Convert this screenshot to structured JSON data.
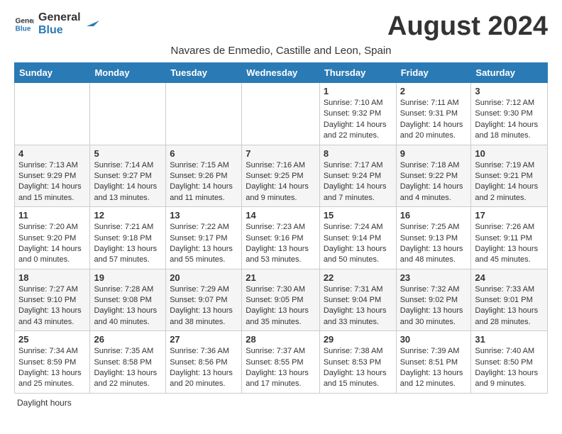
{
  "header": {
    "logo_general": "General",
    "logo_blue": "Blue",
    "month_title": "August 2024",
    "subtitle": "Navares de Enmedio, Castille and Leon, Spain"
  },
  "days_of_week": [
    "Sunday",
    "Monday",
    "Tuesday",
    "Wednesday",
    "Thursday",
    "Friday",
    "Saturday"
  ],
  "weeks": [
    [
      {
        "day": "",
        "sunrise": "",
        "sunset": "",
        "daylight": ""
      },
      {
        "day": "",
        "sunrise": "",
        "sunset": "",
        "daylight": ""
      },
      {
        "day": "",
        "sunrise": "",
        "sunset": "",
        "daylight": ""
      },
      {
        "day": "",
        "sunrise": "",
        "sunset": "",
        "daylight": ""
      },
      {
        "day": "1",
        "sunrise": "Sunrise: 7:10 AM",
        "sunset": "Sunset: 9:32 PM",
        "daylight": "Daylight: 14 hours and 22 minutes."
      },
      {
        "day": "2",
        "sunrise": "Sunrise: 7:11 AM",
        "sunset": "Sunset: 9:31 PM",
        "daylight": "Daylight: 14 hours and 20 minutes."
      },
      {
        "day": "3",
        "sunrise": "Sunrise: 7:12 AM",
        "sunset": "Sunset: 9:30 PM",
        "daylight": "Daylight: 14 hours and 18 minutes."
      }
    ],
    [
      {
        "day": "4",
        "sunrise": "Sunrise: 7:13 AM",
        "sunset": "Sunset: 9:29 PM",
        "daylight": "Daylight: 14 hours and 15 minutes."
      },
      {
        "day": "5",
        "sunrise": "Sunrise: 7:14 AM",
        "sunset": "Sunset: 9:27 PM",
        "daylight": "Daylight: 14 hours and 13 minutes."
      },
      {
        "day": "6",
        "sunrise": "Sunrise: 7:15 AM",
        "sunset": "Sunset: 9:26 PM",
        "daylight": "Daylight: 14 hours and 11 minutes."
      },
      {
        "day": "7",
        "sunrise": "Sunrise: 7:16 AM",
        "sunset": "Sunset: 9:25 PM",
        "daylight": "Daylight: 14 hours and 9 minutes."
      },
      {
        "day": "8",
        "sunrise": "Sunrise: 7:17 AM",
        "sunset": "Sunset: 9:24 PM",
        "daylight": "Daylight: 14 hours and 7 minutes."
      },
      {
        "day": "9",
        "sunrise": "Sunrise: 7:18 AM",
        "sunset": "Sunset: 9:22 PM",
        "daylight": "Daylight: 14 hours and 4 minutes."
      },
      {
        "day": "10",
        "sunrise": "Sunrise: 7:19 AM",
        "sunset": "Sunset: 9:21 PM",
        "daylight": "Daylight: 14 hours and 2 minutes."
      }
    ],
    [
      {
        "day": "11",
        "sunrise": "Sunrise: 7:20 AM",
        "sunset": "Sunset: 9:20 PM",
        "daylight": "Daylight: 14 hours and 0 minutes."
      },
      {
        "day": "12",
        "sunrise": "Sunrise: 7:21 AM",
        "sunset": "Sunset: 9:18 PM",
        "daylight": "Daylight: 13 hours and 57 minutes."
      },
      {
        "day": "13",
        "sunrise": "Sunrise: 7:22 AM",
        "sunset": "Sunset: 9:17 PM",
        "daylight": "Daylight: 13 hours and 55 minutes."
      },
      {
        "day": "14",
        "sunrise": "Sunrise: 7:23 AM",
        "sunset": "Sunset: 9:16 PM",
        "daylight": "Daylight: 13 hours and 53 minutes."
      },
      {
        "day": "15",
        "sunrise": "Sunrise: 7:24 AM",
        "sunset": "Sunset: 9:14 PM",
        "daylight": "Daylight: 13 hours and 50 minutes."
      },
      {
        "day": "16",
        "sunrise": "Sunrise: 7:25 AM",
        "sunset": "Sunset: 9:13 PM",
        "daylight": "Daylight: 13 hours and 48 minutes."
      },
      {
        "day": "17",
        "sunrise": "Sunrise: 7:26 AM",
        "sunset": "Sunset: 9:11 PM",
        "daylight": "Daylight: 13 hours and 45 minutes."
      }
    ],
    [
      {
        "day": "18",
        "sunrise": "Sunrise: 7:27 AM",
        "sunset": "Sunset: 9:10 PM",
        "daylight": "Daylight: 13 hours and 43 minutes."
      },
      {
        "day": "19",
        "sunrise": "Sunrise: 7:28 AM",
        "sunset": "Sunset: 9:08 PM",
        "daylight": "Daylight: 13 hours and 40 minutes."
      },
      {
        "day": "20",
        "sunrise": "Sunrise: 7:29 AM",
        "sunset": "Sunset: 9:07 PM",
        "daylight": "Daylight: 13 hours and 38 minutes."
      },
      {
        "day": "21",
        "sunrise": "Sunrise: 7:30 AM",
        "sunset": "Sunset: 9:05 PM",
        "daylight": "Daylight: 13 hours and 35 minutes."
      },
      {
        "day": "22",
        "sunrise": "Sunrise: 7:31 AM",
        "sunset": "Sunset: 9:04 PM",
        "daylight": "Daylight: 13 hours and 33 minutes."
      },
      {
        "day": "23",
        "sunrise": "Sunrise: 7:32 AM",
        "sunset": "Sunset: 9:02 PM",
        "daylight": "Daylight: 13 hours and 30 minutes."
      },
      {
        "day": "24",
        "sunrise": "Sunrise: 7:33 AM",
        "sunset": "Sunset: 9:01 PM",
        "daylight": "Daylight: 13 hours and 28 minutes."
      }
    ],
    [
      {
        "day": "25",
        "sunrise": "Sunrise: 7:34 AM",
        "sunset": "Sunset: 8:59 PM",
        "daylight": "Daylight: 13 hours and 25 minutes."
      },
      {
        "day": "26",
        "sunrise": "Sunrise: 7:35 AM",
        "sunset": "Sunset: 8:58 PM",
        "daylight": "Daylight: 13 hours and 22 minutes."
      },
      {
        "day": "27",
        "sunrise": "Sunrise: 7:36 AM",
        "sunset": "Sunset: 8:56 PM",
        "daylight": "Daylight: 13 hours and 20 minutes."
      },
      {
        "day": "28",
        "sunrise": "Sunrise: 7:37 AM",
        "sunset": "Sunset: 8:55 PM",
        "daylight": "Daylight: 13 hours and 17 minutes."
      },
      {
        "day": "29",
        "sunrise": "Sunrise: 7:38 AM",
        "sunset": "Sunset: 8:53 PM",
        "daylight": "Daylight: 13 hours and 15 minutes."
      },
      {
        "day": "30",
        "sunrise": "Sunrise: 7:39 AM",
        "sunset": "Sunset: 8:51 PM",
        "daylight": "Daylight: 13 hours and 12 minutes."
      },
      {
        "day": "31",
        "sunrise": "Sunrise: 7:40 AM",
        "sunset": "Sunset: 8:50 PM",
        "daylight": "Daylight: 13 hours and 9 minutes."
      }
    ]
  ],
  "footer": {
    "daylight_note": "Daylight hours"
  }
}
